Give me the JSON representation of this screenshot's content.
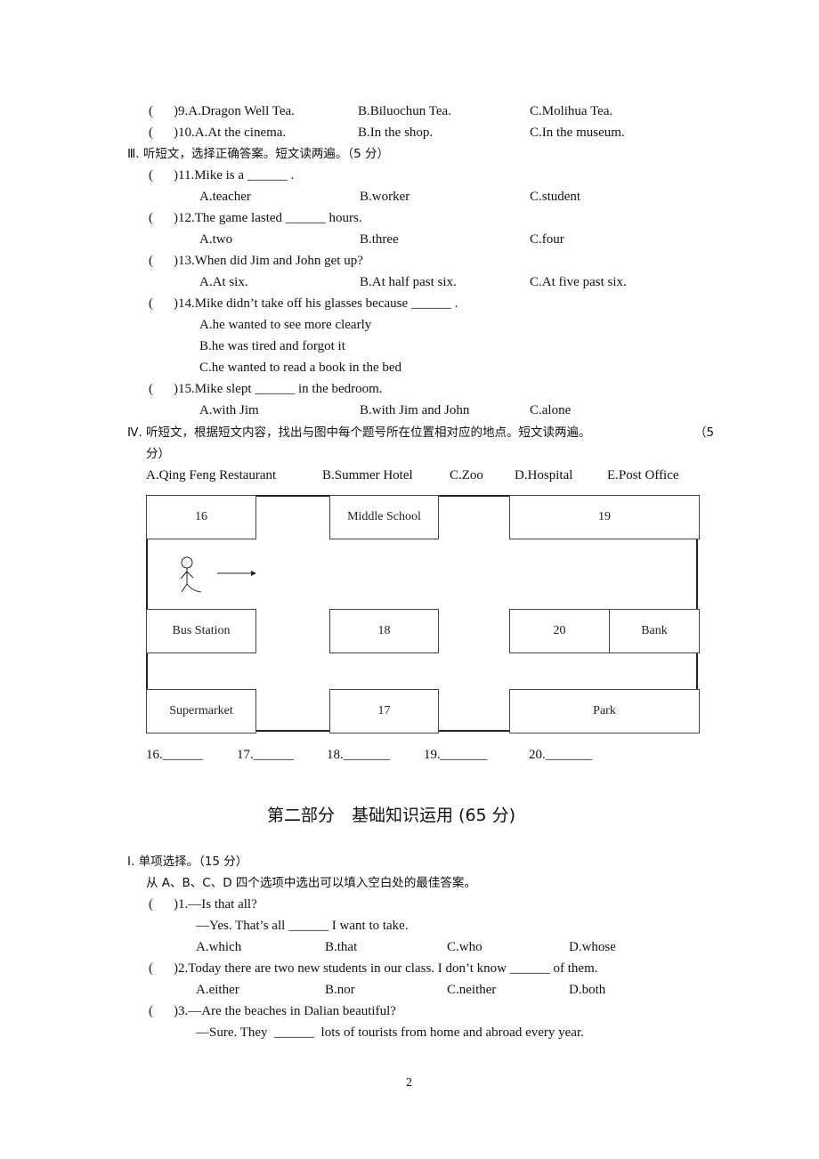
{
  "top_questions": [
    {
      "open": "(",
      "stem": ")9.A.Dragon Well Tea.",
      "b": "B.Biluochun Tea.",
      "c": "C.Molihua Tea."
    },
    {
      "open": "(",
      "stem": ")10.A.At the cinema.",
      "b": "B.In the shop.",
      "c": "C.In the museum."
    }
  ],
  "section3": {
    "heading": "Ⅲ. 听短文，选择正确答案。短文读两遍。（5 分）",
    "questions": [
      {
        "stem": ")11.Mike is a ______ .",
        "a": "A.teacher",
        "b": "B.worker",
        "c": "C.student"
      },
      {
        "stem": ")12.The game lasted ______ hours.",
        "a": "A.two",
        "b": "B.three",
        "c": "C.four"
      },
      {
        "stem": ")13.When did Jim and John get up?",
        "a": "A.At six.",
        "b": "B.At half past six.",
        "c": "C.At five past six."
      },
      {
        "stem": ")14.Mike didn’t take off his glasses because ______ .",
        "a": "A.he wanted to see more clearly",
        "b": "B.he was tired and forgot it",
        "c": "C.he wanted to read a book in the bed"
      },
      {
        "stem": ")15.Mike slept ______ in the bedroom.",
        "a": "A.with Jim",
        "b": "B.with Jim and John",
        "c": "C.alone"
      }
    ]
  },
  "section4": {
    "heading_line1": "Ⅳ. 听短文，根据短文内容，找出与图中每个题号所在位置相对应的地点。短文读两遍。",
    "heading_score_start": "（5",
    "heading_line2": "分）",
    "options": [
      "A.Qing Feng Restaurant",
      "B.Summer Hotel",
      "C.Zoo",
      "D.Hospital",
      "E.Post Office"
    ],
    "map": {
      "b16": "16",
      "middle_school": "Middle School",
      "b19": "19",
      "bus_station": "Bus Station",
      "b18": "18",
      "b20": "20",
      "bank": "Bank",
      "supermarket": "Supermarket",
      "b17": "17",
      "park": "Park"
    },
    "answers": [
      "16.______",
      "17.______",
      "18._______",
      "19._______",
      "20._______"
    ]
  },
  "part2": {
    "title": "第二部分　基础知识运用 (65 分)",
    "section1_heading": "Ⅰ. 单项选择。（15 分）",
    "instruction": "从 A、B、C、D 四个选项中选出可以填入空白处的最佳答案。",
    "q1": {
      "stem": ")1.—Is that all?",
      "line2": "—Yes. That’s all ______ I want to take.",
      "a": "A.which",
      "b": "B.that",
      "c": "C.who",
      "d": "D.whose"
    },
    "q2": {
      "stem": ")2.Today there are two new students in our class. I don’t know ______ of them.",
      "a": "A.either",
      "b": "B.nor",
      "c": "C.neither",
      "d": "D.both"
    },
    "q3": {
      "stem": ")3.—Are the beaches in Dalian beautiful?",
      "line2": "—Sure. They  ______  lots of tourists from home and abroad every year."
    }
  },
  "paren": "(",
  "page_number": "2"
}
